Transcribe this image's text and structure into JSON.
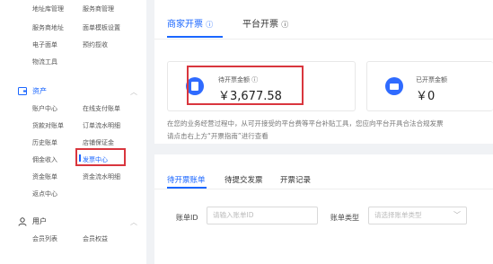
{
  "sidebar": {
    "top_rows": [
      [
        "地址库管理",
        "服务商管理"
      ],
      [
        "服务商地址",
        "面单模板设置"
      ],
      [
        "电子面单",
        "预约揽收"
      ],
      [
        "物流工具",
        ""
      ]
    ],
    "asset_section": {
      "label": "资产",
      "icon": "wallet-icon",
      "color": "#1a66ff"
    },
    "asset_rows": [
      [
        "账户中心",
        "在线支付账单"
      ],
      [
        "货款对账单",
        "订单流水明细"
      ],
      [
        "历史账单",
        "店铺保证金"
      ],
      [
        "佣金收入",
        "发票中心"
      ],
      [
        "资金账单",
        "资金流水明细"
      ],
      [
        "返点中心",
        ""
      ]
    ],
    "active_item": "发票中心",
    "user_section": {
      "label": "用户",
      "icon": "user-icon"
    },
    "user_rows": [
      [
        "会员列表",
        "会员权益"
      ]
    ]
  },
  "main": {
    "tabs": [
      {
        "label": "商家开票",
        "active": true
      },
      {
        "label": "平台开票",
        "active": false
      }
    ],
    "cards": [
      {
        "label": "待开票金额",
        "value": "￥3,677.58",
        "icon": "invoice-icon"
      },
      {
        "label": "已开票金额",
        "value": "￥0",
        "icon": "wallet-card-icon"
      }
    ],
    "notice_lines": [
      "在您的业务经营过程中，从可开接受的平台费等平台补贴工具，您应向平台开具合法合规发票",
      "请点击右上方“开票指南”进行查看"
    ],
    "sub_tabs": [
      {
        "label": "待开票账单",
        "active": true
      },
      {
        "label": "待提交发票",
        "active": false
      },
      {
        "label": "开票记录",
        "active": false
      }
    ],
    "filters": {
      "bill_id_label": "账单ID",
      "bill_id_placeholder": "请输入账单ID",
      "bill_type_label": "账单类型",
      "bill_type_placeholder": "请选择账单类型"
    },
    "accent_color": "#1a66ff",
    "highlight_color": "#d9363e"
  }
}
